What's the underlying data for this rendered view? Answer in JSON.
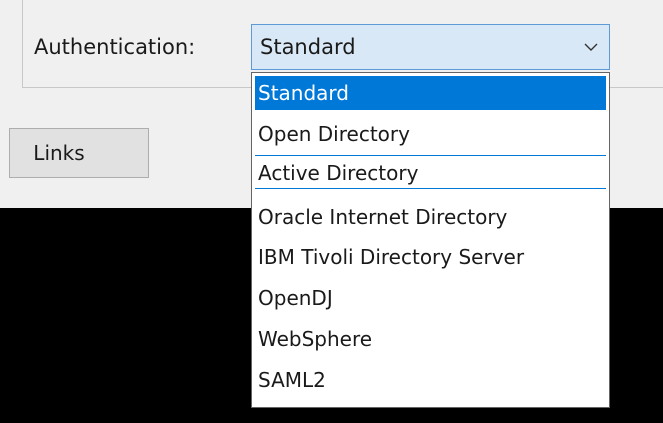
{
  "authentication": {
    "label": "Authentication:",
    "selected_value": "Standard",
    "options": [
      "Standard",
      "Open Directory",
      "Active Directory",
      "Oracle Internet Directory",
      "IBM Tivoli Directory Server",
      "OpenDJ",
      "WebSphere",
      "SAML2"
    ],
    "highlighted_option": "Standard"
  },
  "buttons": {
    "links_label": "Links"
  },
  "colors": {
    "selection": "#0078d7",
    "combo_background": "#d9e8f6"
  },
  "icons": {
    "combo_arrow": "chevron-down-icon"
  }
}
